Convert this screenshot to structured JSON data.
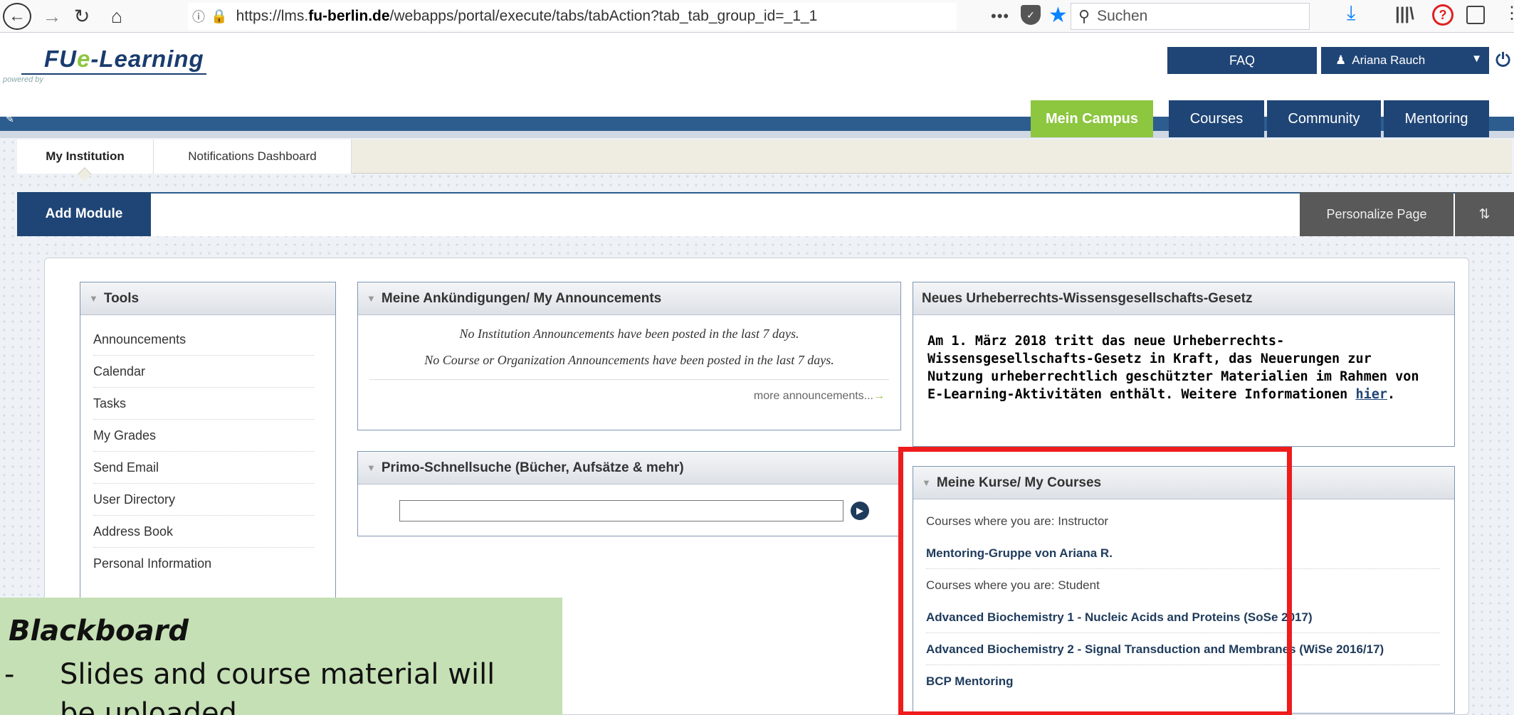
{
  "browser": {
    "url_prefix": "https://lms.",
    "url_domain": "fu-berlin.de",
    "url_suffix": "/webapps/portal/execute/tabs/tabAction?tab_tab_group_id=_1_1",
    "more_label": "•••",
    "search_placeholder": "Suchen"
  },
  "header": {
    "powered_by": "powered by",
    "logo_prefix": "FU",
    "logo_e": "e",
    "logo_suffix": "-Learning",
    "faq_label": "FAQ",
    "user_name": "Ariana Rauch"
  },
  "main_tabs": [
    {
      "label": "Mein Campus",
      "active": true
    },
    {
      "label": "Courses"
    },
    {
      "label": "Community"
    },
    {
      "label": "Mentoring"
    }
  ],
  "sub_tabs": [
    {
      "label": "My Institution",
      "active": true
    },
    {
      "label": "Notifications Dashboard"
    }
  ],
  "actions": {
    "add_module": "Add Module",
    "personalize": "Personalize Page",
    "reorder_icon": "⇅"
  },
  "tools": {
    "title": "Tools",
    "items": [
      "Announcements",
      "Calendar",
      "Tasks",
      "My Grades",
      "Send Email",
      "User Directory",
      "Address Book",
      "Personal Information"
    ]
  },
  "announcements": {
    "title": "Meine Ankündigungen/ My Announcements",
    "line1": "No Institution Announcements have been posted in the last 7 days.",
    "line2": "No Course or Organization Announcements have been posted in the last 7 days.",
    "more": "more announcements..."
  },
  "primo": {
    "title": "Primo-Schnellsuche (Bücher, Aufsätze & mehr)",
    "value": ""
  },
  "urheberrecht": {
    "title": "Neues Urheberrechts-Wissensgesellschafts-Gesetz",
    "line1": "Am 1. März 2018 tritt das neue  Urheberrechts-",
    "line2": "Wissensgesellschafts-Gesetz in Kraft, das Neuerungen zur",
    "line3": "Nutzung urheberrechtlich geschützter Materialien im Rahmen von",
    "line4": "E-Learning-Aktivitäten enthält. Weitere Informationen ",
    "link": "hier",
    "line4_end": "."
  },
  "courses": {
    "title": "Meine Kurse/ My Courses",
    "instructor_label": "Courses where you are: Instructor",
    "instructor_courses": [
      "Mentoring-Gruppe von Ariana R."
    ],
    "student_label": "Courses where you are: Student",
    "student_courses": [
      "Advanced Biochemistry 1 - Nucleic Acids and Proteins (SoSe 2017)",
      "Advanced Biochemistry 2 - Signal Transduction and Membranes (WiSe 2016/17)",
      "BCP Mentoring"
    ]
  },
  "slide_note": {
    "title": "Blackboard",
    "bullet_dash": "-",
    "bullet_line1": "Slides and course material will",
    "bullet_line2": "be uploaded"
  },
  "colors": {
    "brand_blue": "#1f4576",
    "active_green": "#8dc63f",
    "highlight_red": "#ee1c1c",
    "slide_green": "#c5e0b4"
  }
}
